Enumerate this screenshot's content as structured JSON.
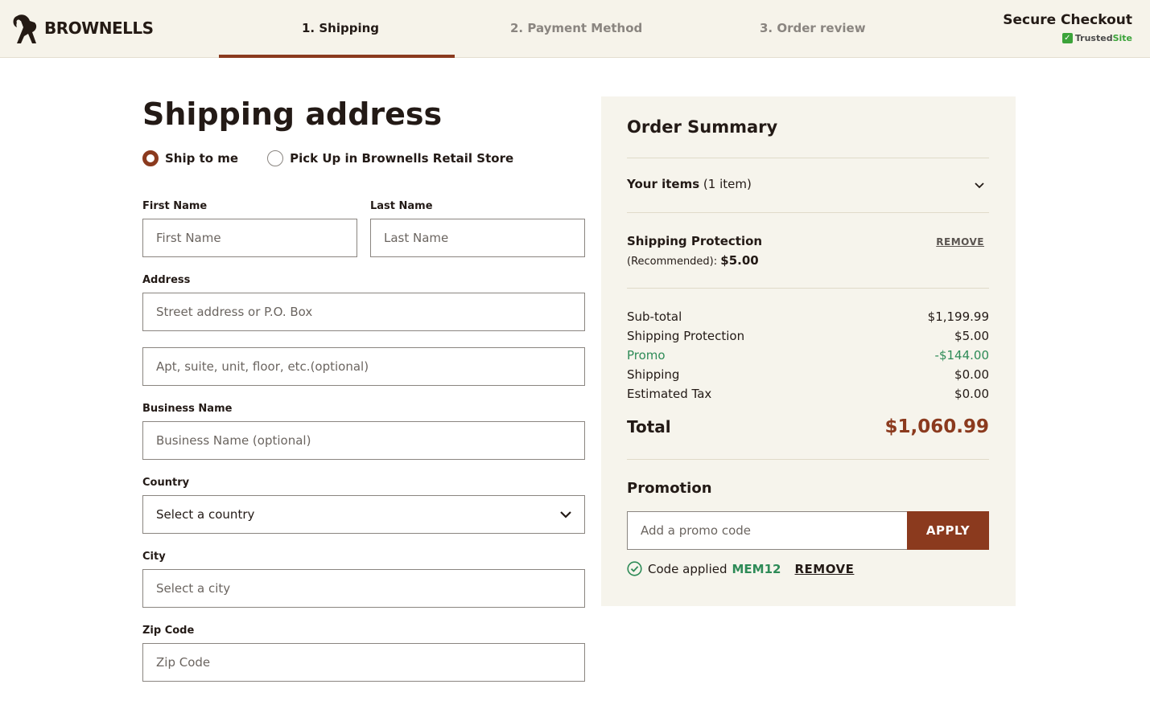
{
  "header": {
    "logo_text": "BROWNELLS",
    "steps": [
      "1. Shipping",
      "2. Payment Method",
      "3. Order review"
    ],
    "secure_title": "Secure Checkout",
    "trusted_a": "Trusted",
    "trusted_b": "Site"
  },
  "form": {
    "title": "Shipping address",
    "radio_ship": "Ship to me",
    "radio_pickup": "Pick Up in Brownells Retail Store",
    "first_name_label": "First Name",
    "first_name_ph": "First Name",
    "last_name_label": "Last Name",
    "last_name_ph": "Last Name",
    "address_label": "Address",
    "address_ph": "Street address or P.O. Box",
    "apt_ph": "Apt, suite, unit, floor, etc.(optional)",
    "business_label": "Business Name",
    "business_ph": "Business Name (optional)",
    "country_label": "Country",
    "country_value": "Select a country",
    "city_label": "City",
    "city_ph": "Select a city",
    "zip_label": "Zip Code",
    "zip_ph": "Zip Code"
  },
  "summary": {
    "title": "Order Summary",
    "items_label": "Your items",
    "items_count": " (1 item)",
    "sp_title": "Shipping Protection",
    "sp_recommended": "(Recommended): ",
    "sp_price": "$5.00",
    "sp_remove": "REMOVE",
    "lines": [
      {
        "label": "Sub-total",
        "value": "$1,199.99"
      },
      {
        "label": "Shipping Protection",
        "value": "$5.00"
      },
      {
        "label": "Promo",
        "value": "-$144.00"
      },
      {
        "label": "Shipping",
        "value": "$0.00"
      },
      {
        "label": "Estimated Tax",
        "value": "$0.00"
      }
    ],
    "total_label": "Total",
    "total_value": "$1,060.99",
    "promo_title": "Promotion",
    "promo_ph": "Add a promo code",
    "apply": "APPLY",
    "code_applied": "Code applied",
    "code": "MEM12",
    "code_remove": "REMOVE"
  },
  "colors": {
    "accent": "#8b3a1e",
    "promo_green": "#2e8b57",
    "header_bg": "#f6f3ea",
    "panel_bg": "#f6f4ec"
  }
}
